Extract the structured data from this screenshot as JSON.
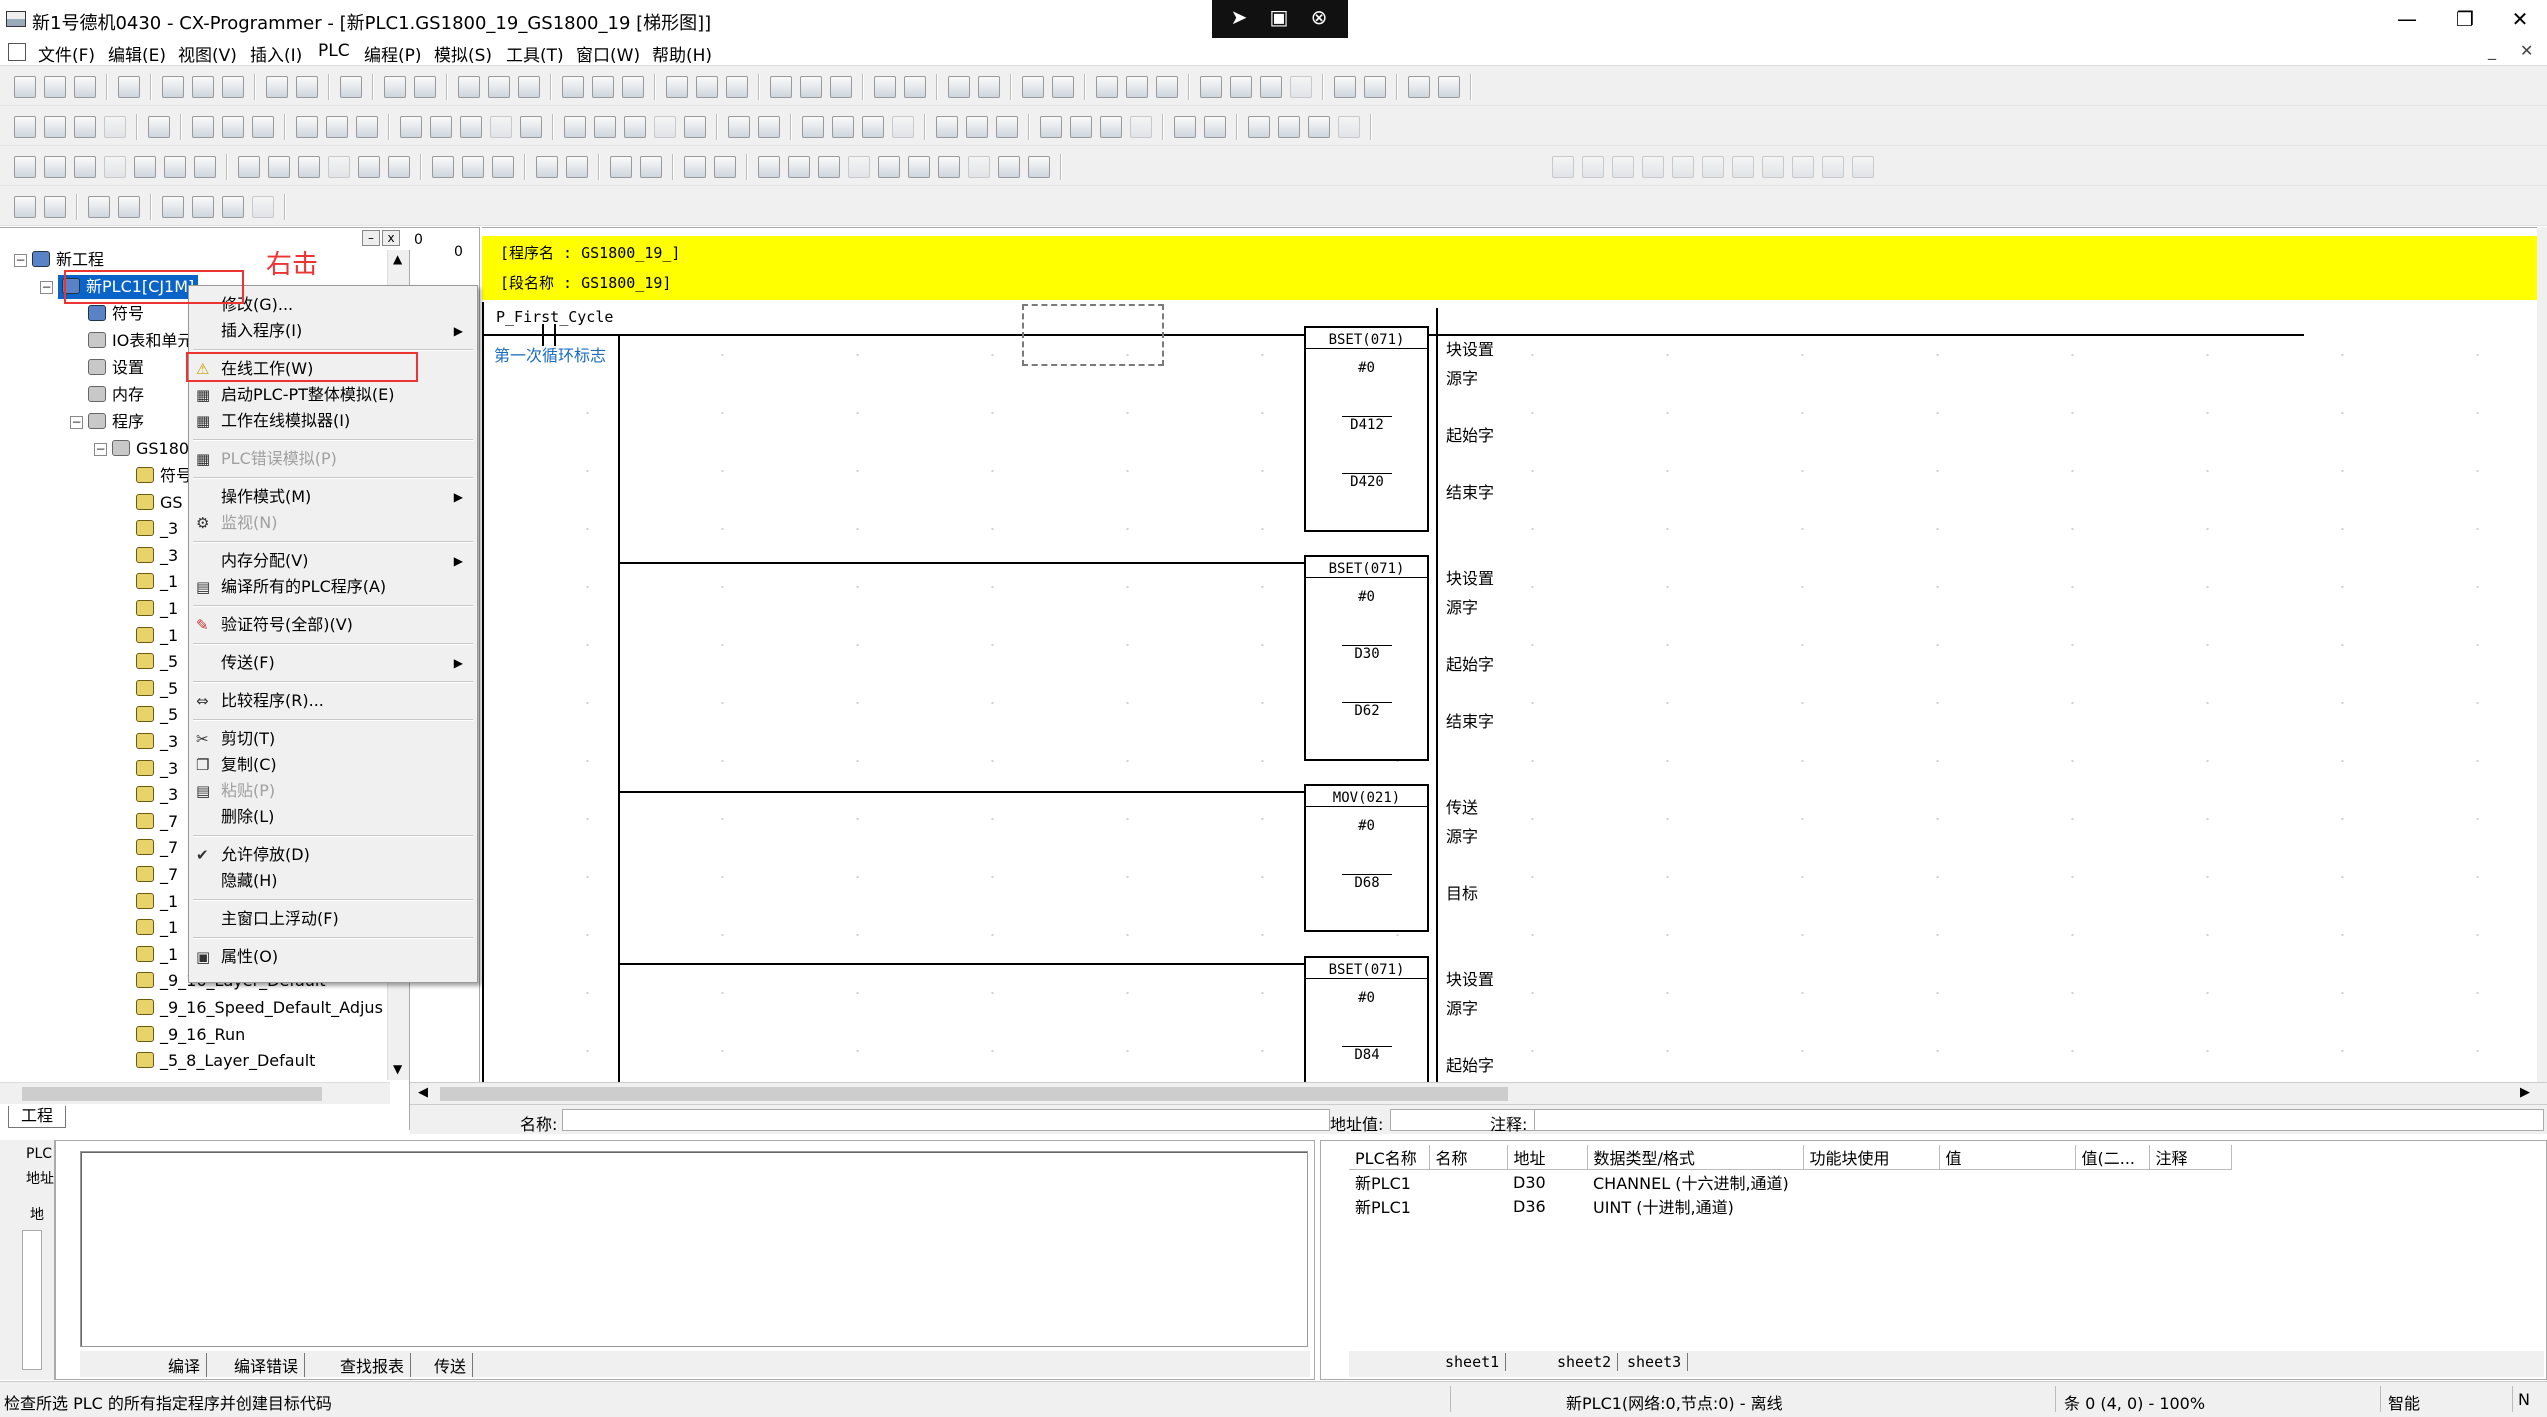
{
  "window": {
    "title": "新1号德机0430 - CX-Programmer - [新PLC1.GS1800_19_GS1800_19 [梯形图]]",
    "minimize": "—",
    "restore": "❐",
    "close": "✕"
  },
  "menu": [
    "文件(F)",
    "编辑(E)",
    "视图(V)",
    "插入(I)",
    "PLC",
    "编程(P)",
    "模拟(S)",
    "工具(T)",
    "窗口(W)",
    "帮助(H)"
  ],
  "tree": {
    "close_btn": "x",
    "items": [
      {
        "label": "新工程",
        "icon": "project-icon"
      },
      {
        "label": "新PLC1[CJ1M]",
        "icon": "plc-icon",
        "selected": true
      },
      {
        "label": "符号",
        "icon": "symbols-icon"
      },
      {
        "label": "IO表和单元",
        "icon": "io-table-icon"
      },
      {
        "label": "设置",
        "icon": "settings-icon"
      },
      {
        "label": "内存",
        "icon": "memory-icon"
      },
      {
        "label": "程序",
        "icon": "programs-icon"
      },
      {
        "label": "GS180",
        "icon": "program-icon"
      },
      {
        "label": "符号",
        "icon": "symbols-icon"
      },
      {
        "label": "GS",
        "icon": "section-icon"
      },
      {
        "label": "_3",
        "icon": "section-icon"
      },
      {
        "label": "_3",
        "icon": "section-icon"
      },
      {
        "label": "_1",
        "icon": "section-icon"
      },
      {
        "label": "_1",
        "icon": "section-icon"
      },
      {
        "label": "_1",
        "icon": "section-icon"
      },
      {
        "label": "_5",
        "icon": "section-icon"
      },
      {
        "label": "_5",
        "icon": "section-icon"
      },
      {
        "label": "_5",
        "icon": "section-icon"
      },
      {
        "label": "_3",
        "icon": "section-icon"
      },
      {
        "label": "_3",
        "icon": "section-icon"
      },
      {
        "label": "_3",
        "icon": "section-icon"
      },
      {
        "label": "_7",
        "icon": "section-icon"
      },
      {
        "label": "_7",
        "icon": "section-icon"
      },
      {
        "label": "_7",
        "icon": "section-icon"
      },
      {
        "label": "_1",
        "icon": "section-icon"
      },
      {
        "label": "_1",
        "icon": "section-icon"
      },
      {
        "label": "_1",
        "icon": "section-icon"
      },
      {
        "label": "_9_16_Layer_Default",
        "icon": "section-icon"
      },
      {
        "label": "_9_16_Speed_Default_Adjus",
        "icon": "section-icon"
      },
      {
        "label": "_9_16_Run",
        "icon": "section-icon"
      },
      {
        "label": "_5_8_Layer_Default",
        "icon": "section-icon"
      }
    ],
    "tab_label": "工程"
  },
  "annotation": {
    "right_click": "右击"
  },
  "context_menu": [
    {
      "label": "修改(G)...",
      "disabled": false,
      "arrow": false
    },
    {
      "label": "插入程序(I)",
      "disabled": false,
      "arrow": true
    },
    {
      "label": "在线工作(W)",
      "disabled": false,
      "arrow": false,
      "highlight": true
    },
    {
      "label": "启动PLC-PT整体模拟(E)",
      "disabled": false,
      "arrow": false
    },
    {
      "label": "工作在线模拟器(I)",
      "disabled": false,
      "arrow": false
    },
    {
      "label": "PLC错误模拟(P)",
      "disabled": true,
      "arrow": false
    },
    {
      "label": "操作模式(M)",
      "disabled": false,
      "arrow": true
    },
    {
      "label": "监视(N)",
      "disabled": true,
      "arrow": false
    },
    {
      "label": "内存分配(V)",
      "disabled": false,
      "arrow": true
    },
    {
      "label": "编译所有的PLC程序(A)",
      "disabled": false,
      "arrow": false
    },
    {
      "label": "验证符号(全部)(V)",
      "disabled": false,
      "arrow": false
    },
    {
      "label": "传送(F)",
      "disabled": false,
      "arrow": true
    },
    {
      "label": "比较程序(R)...",
      "disabled": false,
      "arrow": false
    },
    {
      "label": "剪切(T)",
      "disabled": false,
      "arrow": false
    },
    {
      "label": "复制(C)",
      "disabled": false,
      "arrow": false
    },
    {
      "label": "粘贴(P)",
      "disabled": true,
      "arrow": false
    },
    {
      "label": "删除(L)",
      "disabled": false,
      "arrow": false
    },
    {
      "label": "允许停放(D)",
      "disabled": false,
      "arrow": false,
      "checked": true
    },
    {
      "label": "隐藏(H)",
      "disabled": false,
      "arrow": false
    },
    {
      "label": "主窗口上浮动(F)",
      "disabled": false,
      "arrow": false
    },
    {
      "label": "属性(O)",
      "disabled": false,
      "arrow": false
    }
  ],
  "ladder": {
    "rung_numbers": [
      "0",
      "0"
    ],
    "program_name_line": "[程序名 : GS1800_19_]",
    "section_name_line": "[段名称 : GS1800_19]",
    "contact_label": "P_First_Cycle",
    "contact_comment": "第一次循环标志",
    "blocks": [
      {
        "name": "BSET(071)",
        "operands": [
          "#0",
          "D412",
          "D420"
        ],
        "comments": [
          "块设置",
          "源字",
          "起始字",
          "结束字"
        ]
      },
      {
        "name": "BSET(071)",
        "operands": [
          "#0",
          "D30",
          "D62"
        ],
        "comments": [
          "块设置",
          "源字",
          "起始字",
          "结束字"
        ]
      },
      {
        "name": "MOV(021)",
        "operands": [
          "#0",
          "D68"
        ],
        "comments": [
          "传送",
          "源字",
          "目标"
        ]
      },
      {
        "name": "BSET(071)",
        "operands": [
          "#0",
          "D84"
        ],
        "comments": [
          "块设置",
          "源字",
          "起始字"
        ]
      }
    ]
  },
  "infobar": {
    "name_label": "名称:",
    "address_label": "地址值:",
    "comment_label": "注释:"
  },
  "mini_panel": {
    "plc": "PLC",
    "addr": "地址",
    "addr2": "地"
  },
  "output_tabs": [
    "编译",
    "编译错误",
    "查找报表",
    "传送"
  ],
  "watch": {
    "columns": [
      "PLC名称",
      "名称",
      "地址",
      "数据类型/格式",
      "功能块使用",
      "值",
      "值(二...",
      "注释"
    ],
    "rows": [
      [
        "新PLC1",
        "",
        "D30",
        "CHANNEL (十六进制,通道)",
        "",
        "",
        "",
        ""
      ],
      [
        "新PLC1",
        "",
        "D36",
        "UINT (十进制,通道)",
        "",
        "",
        "",
        ""
      ]
    ],
    "sheets": [
      "sheet1",
      "sheet2",
      "sheet3"
    ]
  },
  "status": {
    "hint": "检查所选 PLC 的所有指定程序并创建目标代码",
    "plc_state": "新PLC1(网络:0,节点:0) - 离线",
    "position": "条 0 (4, 0) - 100%",
    "mode": "智能",
    "num": "N"
  }
}
